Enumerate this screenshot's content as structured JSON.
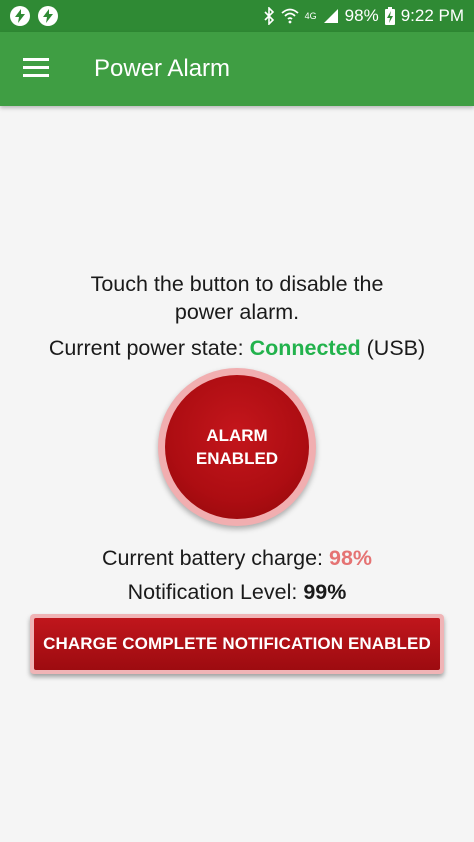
{
  "status_bar": {
    "battery_percent": "98%",
    "time": "9:22 PM",
    "network_label": "4G",
    "icons": [
      "bolt-icon",
      "bolt-icon",
      "bluetooth-icon",
      "wifi-icon",
      "signal-icon",
      "battery-charging-icon"
    ]
  },
  "app_bar": {
    "title": "Power Alarm",
    "menu_icon": "hamburger-menu-icon"
  },
  "main": {
    "instruction_line1": "Touch the button to disable the",
    "instruction_line2": "power alarm.",
    "power_state_label": "Current power state: ",
    "power_state_value": "Connected",
    "power_state_source": " (USB)",
    "alarm_button_line1": "ALARM",
    "alarm_button_line2": "ENABLED",
    "battery_label": "Current battery charge: ",
    "battery_value": "98%",
    "notification_label": "Notification Level: ",
    "notification_value": "99%",
    "charge_button_label": "CHARGE COMPLETE NOTIFICATION ENABLED"
  },
  "colors": {
    "status_bar": "#2f8a34",
    "app_bar": "#3f9e43",
    "connected": "#22b24c",
    "alarm_red": "#ad0d12",
    "battery_value": "#e57373"
  }
}
